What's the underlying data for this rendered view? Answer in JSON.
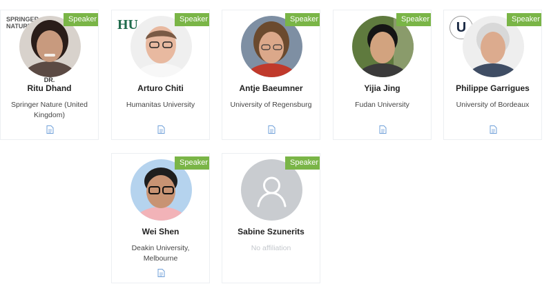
{
  "badge_label": "Speaker",
  "colors": {
    "badge": "#7ab547",
    "doc_icon": "#6e9fd8",
    "placeholder_avatar": "#c9ccd0"
  },
  "speakers": [
    {
      "title": "DR.",
      "name": "Ritu Dhand",
      "affiliation": "Springer Nature (United Kingdom)",
      "logo": "SPRINGER NATURE",
      "doc_icon": "document-icon"
    },
    {
      "name": "Arturo Chiti",
      "affiliation": "Humanitas University",
      "logo": "HU",
      "doc_icon": "document-icon"
    },
    {
      "name": "Antje Baeumner",
      "affiliation": "University of Regensburg",
      "doc_icon": "document-icon"
    },
    {
      "name": "Yijia Jing",
      "affiliation": "Fudan University",
      "doc_icon": "document-icon"
    },
    {
      "name": "Philippe Garrigues",
      "affiliation": "University of Bordeaux",
      "logo": "U",
      "doc_icon": "document-icon"
    },
    {
      "name": "Wei Shen",
      "affiliation": "Deakin University, Melbourne",
      "doc_icon": "document-icon"
    },
    {
      "name": "Sabine Szunerits",
      "affiliation": "No affiliation",
      "avatar": "person-placeholder-icon"
    }
  ]
}
